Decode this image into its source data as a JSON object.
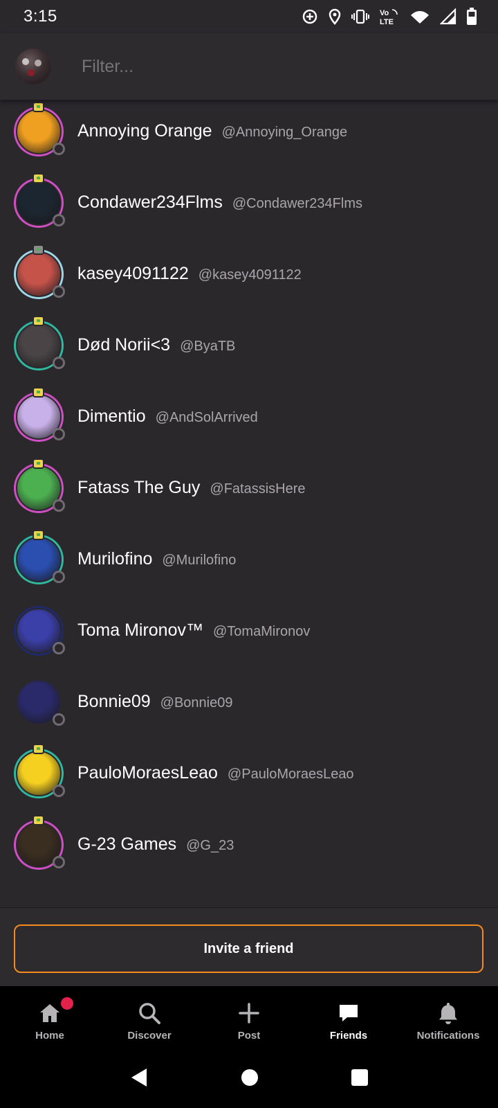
{
  "status_bar": {
    "time": "3:15",
    "icons": [
      "data-saver-icon",
      "location-icon",
      "vibrate-icon",
      "volte-icon",
      "wifi-icon",
      "signal-icon",
      "battery-icon"
    ]
  },
  "header": {
    "filter_placeholder": "Filter..."
  },
  "friends": [
    {
      "name": "Annoying Orange",
      "handle": "@Annoying_Orange",
      "ring": "#d04fc4",
      "avatar": "#f0a020",
      "badge": "yellow"
    },
    {
      "name": "Condawer234Flms",
      "handle": "@Condawer234Flms",
      "ring": "#d04fc4",
      "avatar": "#1c2630",
      "badge": "yellow"
    },
    {
      "name": "kasey4091122",
      "handle": "@kasey4091122",
      "ring": "#9fd6e6",
      "avatar": "#c5534a",
      "badge": "grey"
    },
    {
      "name": "Død Norii<3",
      "handle": "@ByaTB",
      "ring": "#2fb8a0",
      "avatar": "#4a4446",
      "badge": "yellow"
    },
    {
      "name": "Dimentio",
      "handle": "@AndSolArrived",
      "ring": "#d04fc4",
      "avatar": "#c8b0e8",
      "badge": "yellow"
    },
    {
      "name": "Fatass The Guy",
      "handle": "@FatassisHere",
      "ring": "#d04fc4",
      "avatar": "#4caf50",
      "badge": "yellow"
    },
    {
      "name": "Murilofino",
      "handle": "@Murilofino",
      "ring": "#2fb8a0",
      "avatar": "#2a4fb0",
      "badge": "yellow"
    },
    {
      "name": "Toma Mironov™",
      "handle": "@TomaMironov",
      "ring": "#1e2a6a",
      "avatar": "#3b3fa8",
      "badge": "none"
    },
    {
      "name": "Bonnie09",
      "handle": "@Bonnie09",
      "ring": "#2b282c",
      "avatar": "#2a2a6a",
      "badge": "none"
    },
    {
      "name": "PauloMoraesLeao",
      "handle": "@PauloMoraesLeao",
      "ring": "#2fb8a0",
      "avatar": "#f5d020",
      "badge": "yellow"
    },
    {
      "name": "G-23 Games",
      "handle": "@G_23",
      "ring": "#d04fc4",
      "avatar": "#3a2e20",
      "badge": "yellow"
    }
  ],
  "invite_button": "Invite a friend",
  "bottom_nav": [
    {
      "label": "Home",
      "icon": "home-icon"
    },
    {
      "label": "Discover",
      "icon": "search-icon"
    },
    {
      "label": "Post",
      "icon": "plus-icon"
    },
    {
      "label": "Friends",
      "icon": "chat-icon",
      "active": true
    },
    {
      "label": "Notifications",
      "icon": "bell-icon"
    }
  ],
  "colors": {
    "background": "#2b282c",
    "accent": "#f58a1f",
    "notification_dot": "#e3214b"
  }
}
